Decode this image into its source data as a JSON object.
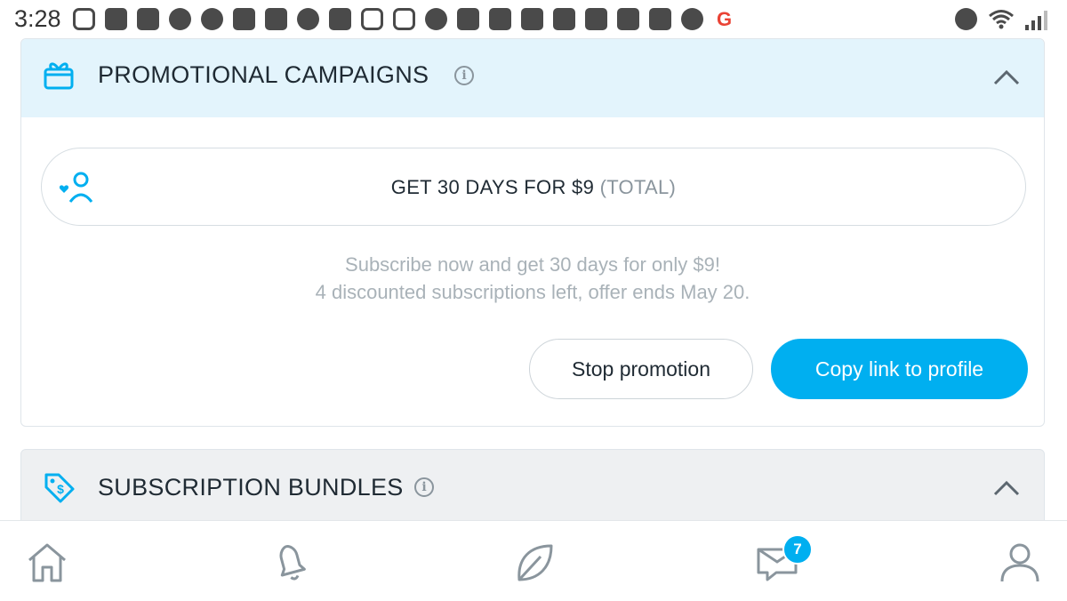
{
  "status_bar": {
    "time": "3:28",
    "notification_icons": [
      "instagram-icon",
      "hand-icon",
      "chat-icon",
      "messenger-icon",
      "add-person-icon",
      "shopping-bag-icon",
      "mewe-icon",
      "cloud-icon",
      "facebook-icon",
      "instagram-icon",
      "instagram-icon",
      "alarm-icon",
      "apps-icon",
      "folder-icon",
      "amazon-icon",
      "image-icon",
      "plug-icon",
      "plug-icon",
      "plug-icon",
      "assistant-icon",
      "google-icon"
    ],
    "system_icons": [
      "alarm-icon",
      "wifi-icon",
      "signal-icon"
    ]
  },
  "promotional_campaigns": {
    "title": "PROMOTIONAL CAMPAIGNS",
    "icon": "gift-icon",
    "expanded": true,
    "promo": {
      "offer_main": "GET 30 DAYS FOR $9",
      "offer_suffix": "(TOTAL)",
      "icon": "user-heart-icon"
    },
    "description_line1": "Subscribe now and get 30 days for only $9!",
    "description_line2": "4 discounted subscriptions left, offer ends May 20.",
    "stop_button": "Stop promotion",
    "copy_button": "Copy link to profile"
  },
  "subscription_bundles": {
    "title": "SUBSCRIPTION BUNDLES",
    "icon": "price-tag-icon",
    "expanded": true
  },
  "bottom_nav": {
    "items": [
      "home-icon",
      "bell-icon",
      "leaf-icon",
      "messages-icon",
      "profile-icon"
    ],
    "messages_badge": "7"
  },
  "colors": {
    "accent": "#00aff0",
    "header_bg": "#e3f4fc",
    "muted_text": "#a9b2b8",
    "icon_gray": "#8a959d"
  }
}
